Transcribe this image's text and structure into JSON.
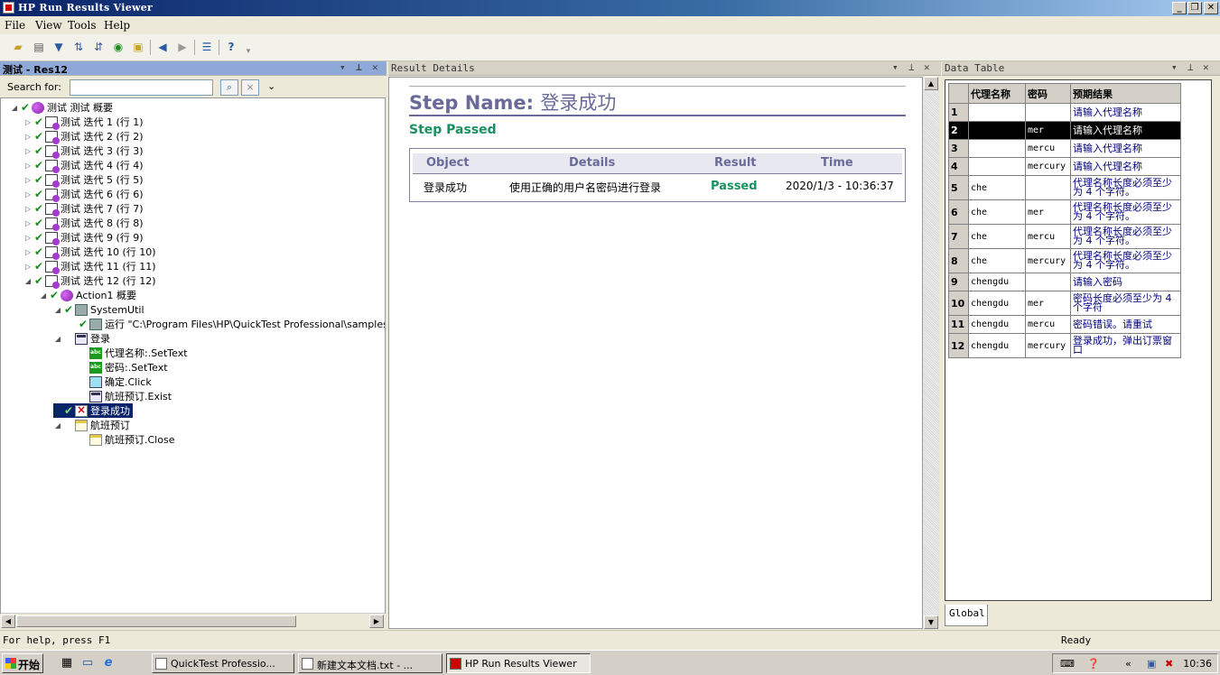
{
  "window": {
    "title": "HP Run Results Viewer",
    "min": "_",
    "restore": "❐",
    "close": "✕"
  },
  "menu": [
    "File",
    "View",
    "Tools",
    "Help"
  ],
  "left_pane": {
    "title": "测试 - Res12",
    "search_label": "Search for:",
    "search_value": "",
    "tree": [
      {
        "label": "测试 测试 概要",
        "icon": "summary",
        "check": true,
        "exp": "◢"
      },
      {
        "label": "测试 迭代 1 (行 1)",
        "icon": "doc",
        "check": true,
        "exp": "▷"
      },
      {
        "label": "测试 迭代 2 (行 2)",
        "icon": "doc",
        "check": true,
        "exp": "▷"
      },
      {
        "label": "测试 迭代 3 (行 3)",
        "icon": "doc",
        "check": true,
        "exp": "▷"
      },
      {
        "label": "测试 迭代 4 (行 4)",
        "icon": "doc",
        "check": true,
        "exp": "▷"
      },
      {
        "label": "测试 迭代 5 (行 5)",
        "icon": "doc",
        "check": true,
        "exp": "▷"
      },
      {
        "label": "测试 迭代 6 (行 6)",
        "icon": "doc",
        "check": true,
        "exp": "▷"
      },
      {
        "label": "测试 迭代 7 (行 7)",
        "icon": "doc",
        "check": true,
        "exp": "▷"
      },
      {
        "label": "测试 迭代 8 (行 8)",
        "icon": "doc",
        "check": true,
        "exp": "▷"
      },
      {
        "label": "测试 迭代 9 (行 9)",
        "icon": "doc",
        "check": true,
        "exp": "▷"
      },
      {
        "label": "测试 迭代 10 (行 10)",
        "icon": "doc",
        "check": true,
        "exp": "▷"
      },
      {
        "label": "测试 迭代 11 (行 11)",
        "icon": "doc",
        "check": true,
        "exp": "▷"
      },
      {
        "label": "测试 迭代 12 (行 12)",
        "icon": "doc",
        "check": true,
        "exp": "◢"
      },
      {
        "label": "Action1 概要",
        "icon": "summary",
        "check": true,
        "exp": "◢"
      },
      {
        "label": "SystemUtil",
        "icon": "sys",
        "check": true,
        "exp": "◢"
      },
      {
        "label": "运行 \"C:\\Program Files\\HP\\QuickTest Professional\\samples\\flig",
        "icon": "sys",
        "check": true,
        "exp": ""
      },
      {
        "label": "登录",
        "icon": "page",
        "check": false,
        "exp": "◢"
      },
      {
        "label": "代理名称:.SetText",
        "icon": "abc",
        "check": false,
        "exp": ""
      },
      {
        "label": "密码:.SetText",
        "icon": "abc",
        "check": false,
        "exp": ""
      },
      {
        "label": "确定.Click",
        "icon": "ok",
        "check": false,
        "exp": ""
      },
      {
        "label": "航班预订.Exist",
        "icon": "page",
        "check": false,
        "exp": ""
      },
      {
        "label": "登录成功",
        "icon": "fail",
        "check": true,
        "exp": "",
        "selected": true
      },
      {
        "label": "航班预订",
        "icon": "win",
        "check": false,
        "exp": "◢"
      },
      {
        "label": "航班预订.Close",
        "icon": "win",
        "check": false,
        "exp": ""
      }
    ]
  },
  "middle_pane": {
    "title": "Result Details",
    "step_name_label": "Step Name:",
    "step_name_value": "登录成功",
    "step_status": "Step Passed",
    "headers": [
      "Object",
      "Details",
      "Result",
      "Time"
    ],
    "row": {
      "object": "登录成功",
      "details": "使用正确的用户名密码进行登录",
      "result": "Passed",
      "time": "2020/1/3 - 10:36:37"
    }
  },
  "right_pane": {
    "title": "Data Table",
    "headers": [
      "代理名称",
      "密码",
      "预期结果"
    ],
    "rows": [
      {
        "n": "1",
        "a": "",
        "b": "",
        "c": "请输入代理名称"
      },
      {
        "n": "2",
        "a": "",
        "b": "mer",
        "c": "请输入代理名称"
      },
      {
        "n": "3",
        "a": "",
        "b": "mercu",
        "c": "请输入代理名称"
      },
      {
        "n": "4",
        "a": "",
        "b": "mercury",
        "c": "请输入代理名称"
      },
      {
        "n": "5",
        "a": "che",
        "b": "",
        "c": "代理名称长度必须至少为 4 个字符。"
      },
      {
        "n": "6",
        "a": "che",
        "b": "mer",
        "c": "代理名称长度必须至少为 4 个字符。"
      },
      {
        "n": "7",
        "a": "che",
        "b": "mercu",
        "c": "代理名称长度必须至少为 4 个字符。"
      },
      {
        "n": "8",
        "a": "che",
        "b": "mercury",
        "c": "代理名称长度必须至少为 4 个字符。"
      },
      {
        "n": "9",
        "a": "chengdu",
        "b": "",
        "c": "请输入密码"
      },
      {
        "n": "10",
        "a": "chengdu",
        "b": "mer",
        "c": "密码长度必须至少为 4 个字符"
      },
      {
        "n": "11",
        "a": "chengdu",
        "b": "mercu",
        "c": "密码错误。请重试"
      },
      {
        "n": "12",
        "a": "chengdu",
        "b": "mercury",
        "c": "登录成功，弹出订票窗口"
      }
    ],
    "selected_row": "2",
    "tab": "Global"
  },
  "status": {
    "help": "For help, press F1",
    "ready": "Ready"
  },
  "taskbar": {
    "start": "开始",
    "tasks": [
      "QuickTest Professio...",
      "新建文本文档.txt - ...",
      "HP Run Results Viewer"
    ],
    "clock": "10:36"
  }
}
